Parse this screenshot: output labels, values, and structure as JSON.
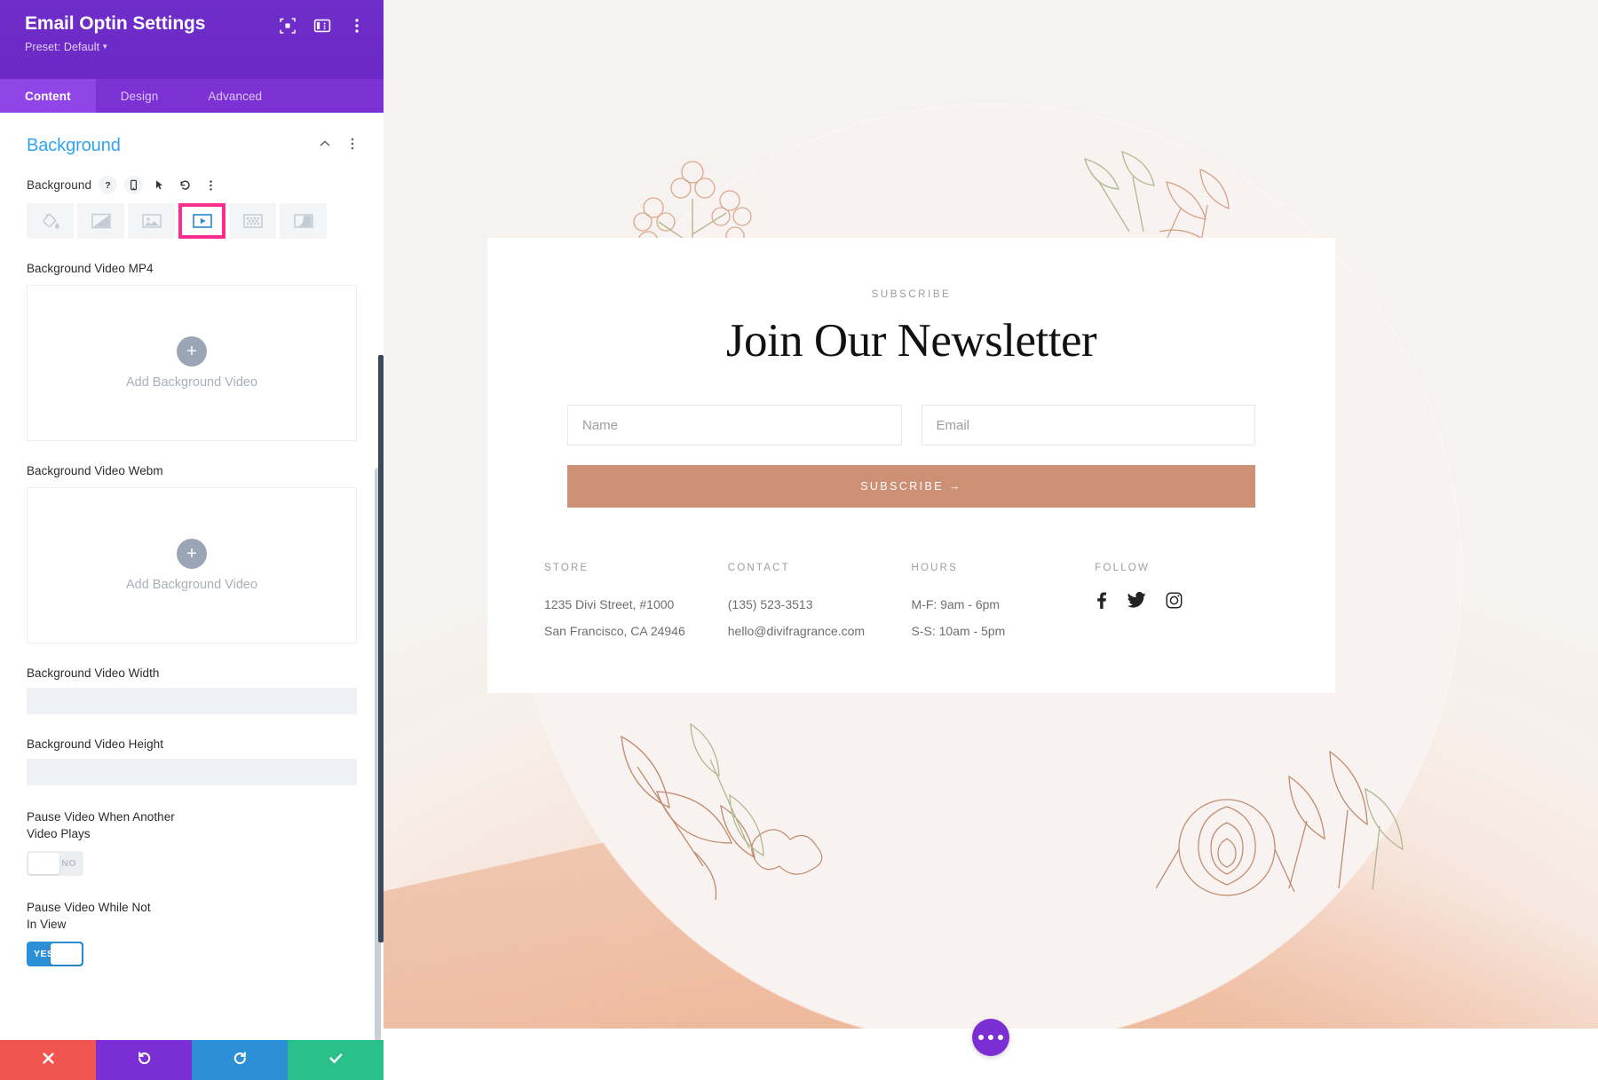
{
  "sidebar": {
    "title": "Email Optin Settings",
    "preset_label": "Preset: Default",
    "header_icons": [
      {
        "name": "focus-icon"
      },
      {
        "name": "panel-layout-icon"
      },
      {
        "name": "more-vertical-icon"
      }
    ],
    "tabs": [
      {
        "label": "Content",
        "active": true
      },
      {
        "label": "Design",
        "active": false
      },
      {
        "label": "Advanced",
        "active": false
      }
    ],
    "section": {
      "title": "Background",
      "collapse_icon": "chevron-up-icon",
      "more_icon": "more-vertical-icon"
    },
    "background_field": {
      "label": "Background",
      "mini_icons": [
        "help-icon",
        "mobile-icon",
        "cursor-icon",
        "reset-icon",
        "more-vertical-icon"
      ],
      "types": [
        {
          "name": "background-color",
          "icon": "paint-bucket-icon",
          "selected": false
        },
        {
          "name": "background-gradient",
          "icon": "gradient-icon",
          "selected": false
        },
        {
          "name": "background-image",
          "icon": "image-icon",
          "selected": false
        },
        {
          "name": "background-video",
          "icon": "video-icon",
          "selected": true
        },
        {
          "name": "background-pattern",
          "icon": "pattern-icon",
          "selected": false
        },
        {
          "name": "background-mask",
          "icon": "mask-icon",
          "selected": false
        }
      ]
    },
    "fields": {
      "mp4_label": "Background Video MP4",
      "mp4_upload_text": "Add Background Video",
      "webm_label": "Background Video Webm",
      "webm_upload_text": "Add Background Video",
      "width_label": "Background Video Width",
      "width_value": "",
      "height_label": "Background Video Height",
      "height_value": "",
      "pause_other_label": "Pause Video When Another Video Plays",
      "pause_other_state": "NO",
      "pause_view_label": "Pause Video While Not In View",
      "pause_view_state": "YES"
    },
    "footer_buttons": [
      {
        "name": "discard-button",
        "icon": "close-icon",
        "color": "#f0554f"
      },
      {
        "name": "undo-button",
        "icon": "undo-icon",
        "color": "#7b2ed4"
      },
      {
        "name": "redo-button",
        "icon": "redo-icon",
        "color": "#2d8fd5"
      },
      {
        "name": "save-button",
        "icon": "check-icon",
        "color": "#2ac08b"
      }
    ]
  },
  "preview": {
    "eyebrow": "SUBSCRIBE",
    "headline": "Join Our Newsletter",
    "name_placeholder": "Name",
    "email_placeholder": "Email",
    "subscribe_label": "SUBSCRIBE →",
    "columns": [
      {
        "heading": "STORE",
        "lines": [
          "1235 Divi Street, #1000",
          "San Francisco, CA 24946"
        ]
      },
      {
        "heading": "CONTACT",
        "lines": [
          "(135) 523-3513",
          "hello@divifragrance.com"
        ]
      },
      {
        "heading": "HOURS",
        "lines": [
          "M-F: 9am - 6pm",
          "S-S: 10am - 5pm"
        ]
      },
      {
        "heading": "FOLLOW",
        "lines": [],
        "social": [
          "facebook-icon",
          "twitter-icon",
          "instagram-icon"
        ]
      }
    ],
    "fab_icon": "more-horizontal-icon"
  },
  "colors": {
    "brand_purple": "#6f2dc9",
    "tab_purple": "#8f45e8",
    "accent_blue": "#2ea3f2",
    "selected_pink": "#ff2d8e",
    "subscribe_tan": "#cd9074",
    "toggle_on_blue": "#2d8fd5"
  }
}
